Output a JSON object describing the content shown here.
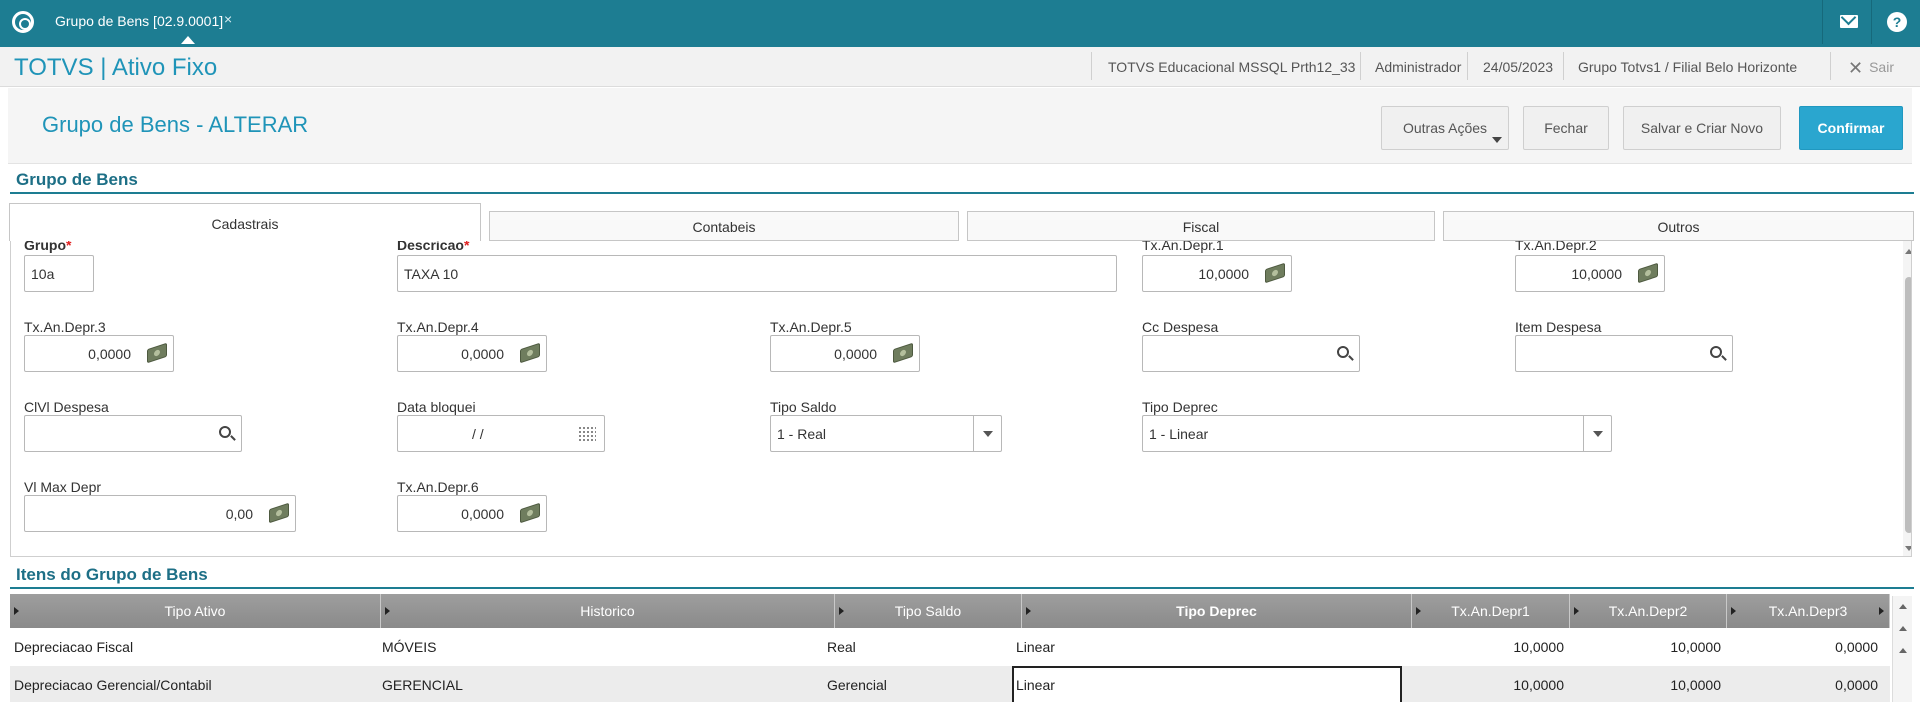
{
  "topbar": {
    "tab_label": "Grupo de Bens [02.9.0001]",
    "tab_close": "×",
    "mail_icon": "mail-icon",
    "help_icon": "help-icon",
    "help_glyph": "?"
  },
  "header": {
    "app_title": "TOTVS | Ativo Fixo",
    "environment": "TOTVS Educacional MSSQL Prth12_33",
    "user": "Administrador",
    "date": "24/05/2023",
    "branch": "Grupo Totvs1 / Filial Belo Horizonte",
    "exit_label": "Sair",
    "exit_glyph": "✕"
  },
  "page": {
    "title": "Grupo de Bens - ALTERAR",
    "buttons": {
      "other_actions": "Outras Ações",
      "close": "Fechar",
      "save_new": "Salvar e Criar Novo",
      "confirm": "Confirmar"
    }
  },
  "form": {
    "section_title": "Grupo de Bens",
    "tabs": [
      "Cadastrais",
      "Contabeis",
      "Fiscal",
      "Outros"
    ],
    "required_mark": "*",
    "fields": {
      "grupo": {
        "label": "Grupo",
        "value": "10a"
      },
      "descricao": {
        "label": "Descricao",
        "value": "TAXA 10"
      },
      "tx_depr1": {
        "label": "Tx.An.Depr.1",
        "value": "10,0000"
      },
      "tx_depr2": {
        "label": "Tx.An.Depr.2",
        "value": "10,0000"
      },
      "tx_depr3": {
        "label": "Tx.An.Depr.3",
        "value": "0,0000"
      },
      "tx_depr4": {
        "label": "Tx.An.Depr.4",
        "value": "0,0000"
      },
      "tx_depr5": {
        "label": "Tx.An.Depr.5",
        "value": "0,0000"
      },
      "cc_despesa": {
        "label": "Cc Despesa",
        "value": ""
      },
      "item_despesa": {
        "label": "Item Despesa",
        "value": ""
      },
      "clvl_despesa": {
        "label": "ClVl Despesa",
        "value": ""
      },
      "data_bloqueio": {
        "label": "Data bloquei",
        "value": "/  /"
      },
      "tipo_saldo": {
        "label": "Tipo Saldo",
        "value": "1 - Real"
      },
      "tipo_deprec": {
        "label": "Tipo Deprec",
        "value": "1 - Linear"
      },
      "vl_max_depr": {
        "label": "Vl Max Depr",
        "value": "0,00"
      },
      "tx_depr6": {
        "label": "Tx.An.Depr.6",
        "value": "0,0000"
      }
    }
  },
  "items": {
    "section_title": "Itens do Grupo de Bens",
    "columns": [
      "Tipo Ativo",
      "Historico",
      "Tipo Saldo",
      "Tipo Deprec",
      "Tx.An.Depr1",
      "Tx.An.Depr2",
      "Tx.An.Depr3"
    ],
    "rows": [
      [
        "Depreciacao Fiscal",
        "MÓVEIS",
        "Real",
        "Linear",
        "10,0000",
        "10,0000",
        "0,0000"
      ],
      [
        "Depreciacao Gerencial/Contabil",
        "GERENCIAL",
        "Gerencial",
        "Linear",
        "10,0000",
        "10,0000",
        "0,0000"
      ]
    ]
  }
}
